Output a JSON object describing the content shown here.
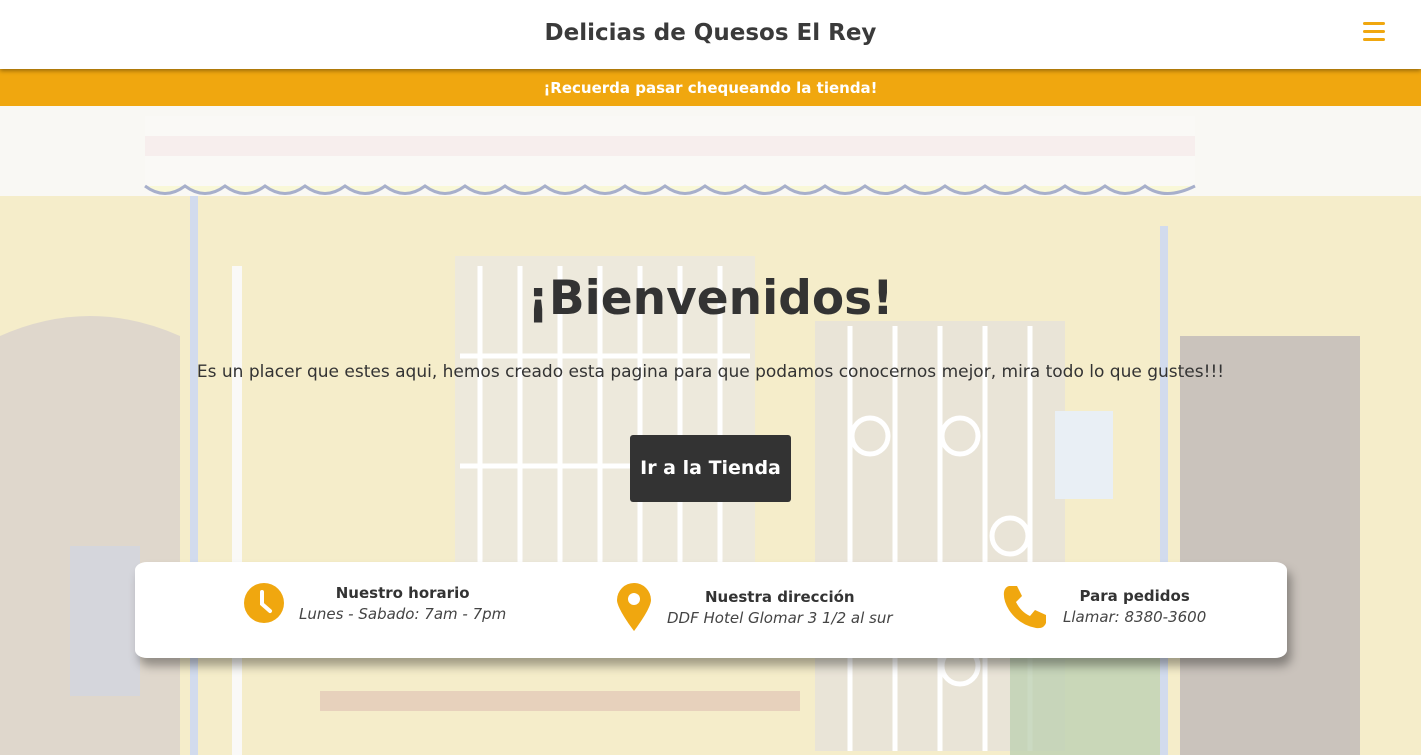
{
  "navbar": {
    "brand": "Delicias de Quesos El Rey",
    "menu_icon": "hamburger-icon"
  },
  "announcement": "¡Recuerda pasar chequeando la tienda!",
  "hero": {
    "title": "¡Bienvenidos!",
    "subtitle": "Es un placer que estes aqui, hemos creado esta pagina para que podamos conocernos mejor, mira todo lo que gustes!!!",
    "button_label": "Ir a la Tienda"
  },
  "info": [
    {
      "icon": "clock-icon",
      "title": "Nuestro horario",
      "detail": "Lunes - Sabado: 7am - 7pm"
    },
    {
      "icon": "location-pin-icon",
      "title": "Nuestra dirección",
      "detail": "DDF Hotel Glomar 3 1/2 al sur"
    },
    {
      "icon": "phone-icon",
      "title": "Para pedidos",
      "detail": "Llamar: 8380-3600"
    }
  ],
  "colors": {
    "accent": "#f0a70f",
    "dark": "#333333",
    "white": "#ffffff"
  }
}
